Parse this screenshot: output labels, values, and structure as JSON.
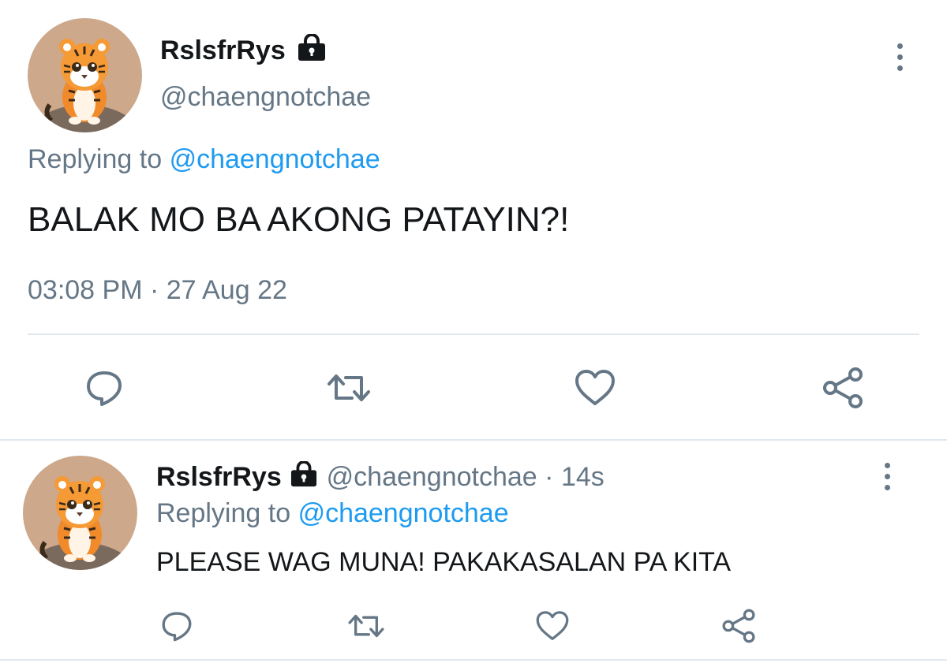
{
  "main_tweet": {
    "display_name": "RslsfrRys",
    "handle": "@chaengnotchae",
    "replying_prefix": "Replying to",
    "replying_to": "@chaengnotchae",
    "text": "BALAK MO BA AKONG PATAYIN?!",
    "timestamp": "03:08 PM · 27 Aug 22",
    "avatar_icon": "tiger-avatar",
    "locked_icon": "lock-icon",
    "actions": [
      "reply-icon",
      "retweet-icon",
      "like-icon",
      "share-icon"
    ]
  },
  "reply_tweet": {
    "display_name": "RslsfrRys",
    "handle": "@chaengnotchae",
    "separator": "·",
    "time_ago": "14s",
    "replying_prefix": "Replying to",
    "replying_to": "@chaengnotchae",
    "text": "PLEASE WAG MUNA! PAKAKASALAN PA KITA",
    "avatar_icon": "tiger-avatar",
    "locked_icon": "lock-icon",
    "actions": [
      "reply-icon",
      "retweet-icon",
      "like-icon",
      "share-icon"
    ]
  },
  "colors": {
    "text": "#14171a",
    "muted": "#657786",
    "link": "#1d9bf0",
    "divider": "#e1e8ed",
    "avatar_bg": "#cda88b"
  }
}
